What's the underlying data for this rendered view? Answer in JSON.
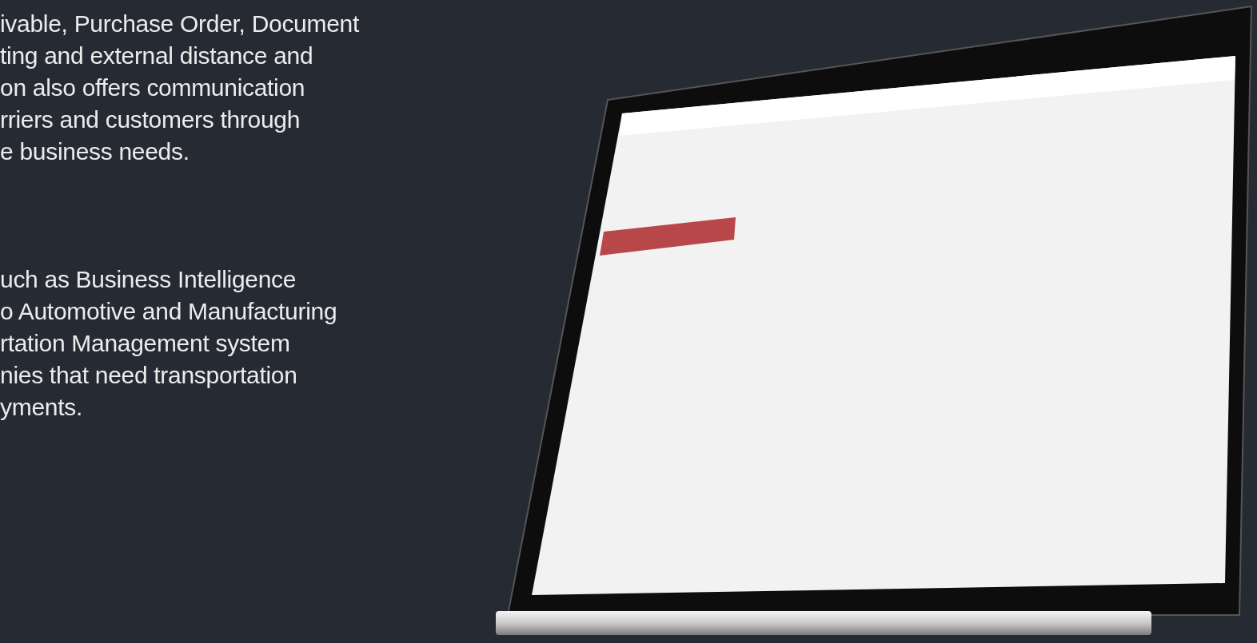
{
  "paragraphs": [
    {
      "lines": [
        "ivable, Purchase Order, Document",
        "ting and external distance and",
        "on also offers communication",
        "rriers and customers through",
        "e business needs."
      ]
    },
    {
      "lines": [
        "uch as Business Intelligence",
        "o Automotive and Manufacturing",
        "rtation Management system",
        "nies that need transportation",
        "yments."
      ]
    }
  ]
}
